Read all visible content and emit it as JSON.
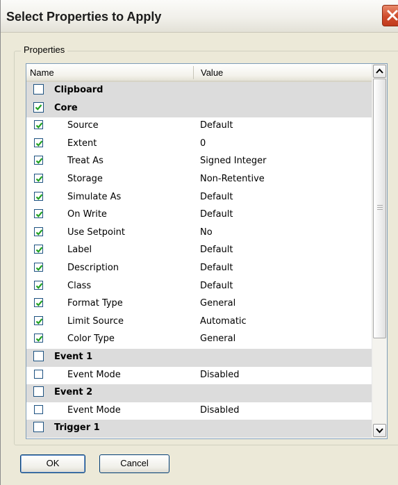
{
  "window": {
    "title": "Select Properties to Apply"
  },
  "group": {
    "label": "Properties"
  },
  "table": {
    "columns": {
      "name": "Name",
      "value": "Value"
    },
    "rows": [
      {
        "kind": "category",
        "name": "Clipboard",
        "value": "",
        "checked": false
      },
      {
        "kind": "category",
        "name": "Core",
        "value": "",
        "checked": true
      },
      {
        "kind": "property",
        "name": "Source",
        "value": "Default",
        "checked": true
      },
      {
        "kind": "property",
        "name": "Extent",
        "value": "0",
        "checked": true
      },
      {
        "kind": "property",
        "name": "Treat As",
        "value": "Signed Integer",
        "checked": true
      },
      {
        "kind": "property",
        "name": "Storage",
        "value": "Non-Retentive",
        "checked": true
      },
      {
        "kind": "property",
        "name": "Simulate As",
        "value": "Default",
        "checked": true
      },
      {
        "kind": "property",
        "name": "On Write",
        "value": "Default",
        "checked": true
      },
      {
        "kind": "property",
        "name": "Use Setpoint",
        "value": "No",
        "checked": true
      },
      {
        "kind": "property",
        "name": "Label",
        "value": "Default",
        "checked": true
      },
      {
        "kind": "property",
        "name": "Description",
        "value": "Default",
        "checked": true
      },
      {
        "kind": "property",
        "name": "Class",
        "value": "Default",
        "checked": true
      },
      {
        "kind": "property",
        "name": "Format Type",
        "value": "General",
        "checked": true
      },
      {
        "kind": "property",
        "name": "Limit Source",
        "value": "Automatic",
        "checked": true
      },
      {
        "kind": "property",
        "name": "Color Type",
        "value": "General",
        "checked": true
      },
      {
        "kind": "category",
        "name": "Event 1",
        "value": "",
        "checked": false
      },
      {
        "kind": "property",
        "name": "Event Mode",
        "value": "Disabled",
        "checked": false
      },
      {
        "kind": "category",
        "name": "Event 2",
        "value": "",
        "checked": false
      },
      {
        "kind": "property",
        "name": "Event Mode",
        "value": "Disabled",
        "checked": false
      },
      {
        "kind": "category",
        "name": "Trigger 1",
        "value": "",
        "checked": false
      }
    ]
  },
  "buttons": {
    "ok": "OK",
    "cancel": "Cancel"
  },
  "icons": {
    "close": "close-icon",
    "check": "checkmark-icon",
    "up": "scroll-up-icon",
    "down": "scroll-down-icon"
  },
  "colors": {
    "titlebar": "#f1f0ea",
    "close": "#cf4b2b",
    "check": "#21a121",
    "category_row": "#dcdcdc",
    "dialog_bg": "#ece9d8"
  }
}
